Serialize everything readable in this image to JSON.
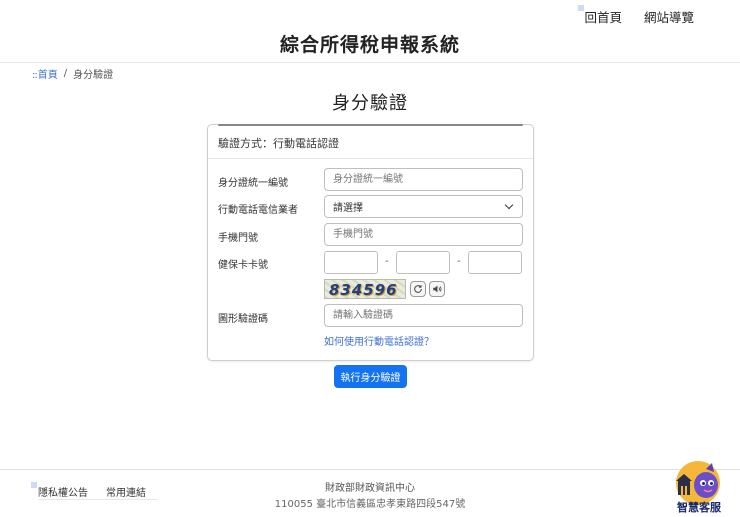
{
  "header": {
    "nav": [
      {
        "label": "回首頁"
      },
      {
        "label": "網站導覽"
      }
    ],
    "site_title": "綜合所得稅申報系統"
  },
  "breadcrumb": {
    "home_marker": "::",
    "home": "首頁",
    "separator": "/",
    "current": "身分驗證"
  },
  "page_title": "身分驗證",
  "form": {
    "method_label": "驗證方式：行動電話認證",
    "fields": {
      "id_label": "身分證統一編號",
      "id_placeholder": "身分證統一編號",
      "carrier_label": "行動電話電信業者",
      "carrier_value": "請選擇",
      "phone_label": "手機門號",
      "phone_placeholder": "手機門號",
      "nhi_label": "健保卡卡號",
      "nhi_sep": "-",
      "captcha_label": "圖形驗證碼",
      "captcha_placeholder": "請輸入驗證碼"
    },
    "captcha_text": "834596",
    "help_link": "如何使用行動電話認證？",
    "submit_label": "執行身分驗證"
  },
  "footer": {
    "links": [
      {
        "label": "隱私權公告"
      },
      {
        "label": "常用連結"
      }
    ],
    "org": "財政部財政資訊中心",
    "address": "110055 臺北市信義區忠孝東路四段547號"
  },
  "chatbot": {
    "label": "智慧客服"
  },
  "colors": {
    "primary": "#1473f0",
    "link": "#3d6fd6",
    "chatbot_text": "#1b2a6b"
  }
}
